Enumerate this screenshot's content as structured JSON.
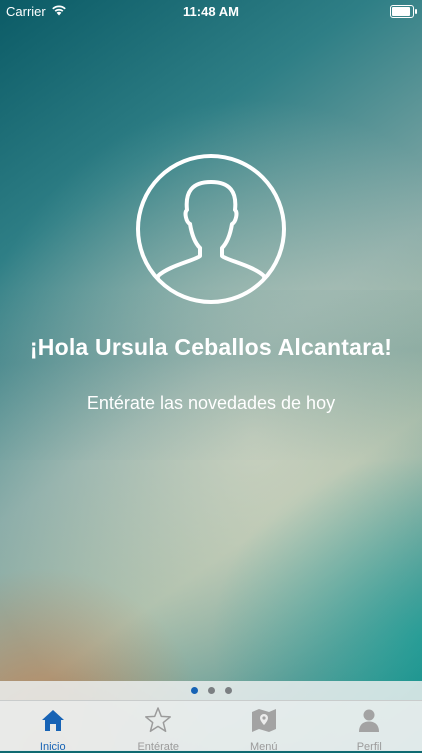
{
  "status_bar": {
    "carrier": "Carrier",
    "time": "11:48 AM",
    "battery_level": 1.0
  },
  "home": {
    "greeting": "¡Hola Ursula Ceballos Alcantara!",
    "subtitle": "Entérate las novedades de hoy",
    "avatar_icon": "user-silhouette-icon"
  },
  "pager": {
    "pages": 3,
    "current": 1
  },
  "tabs": [
    {
      "label": "Inicio",
      "icon": "home-icon",
      "active": true
    },
    {
      "label": "Entérate",
      "icon": "star-icon",
      "active": false
    },
    {
      "label": "Menú",
      "icon": "map-icon",
      "active": false
    },
    {
      "label": "Perfil",
      "icon": "person-icon",
      "active": false
    }
  ],
  "colors": {
    "accent": "#1763b5",
    "inactive": "#9b9b9b",
    "background": "#0f6a71"
  }
}
